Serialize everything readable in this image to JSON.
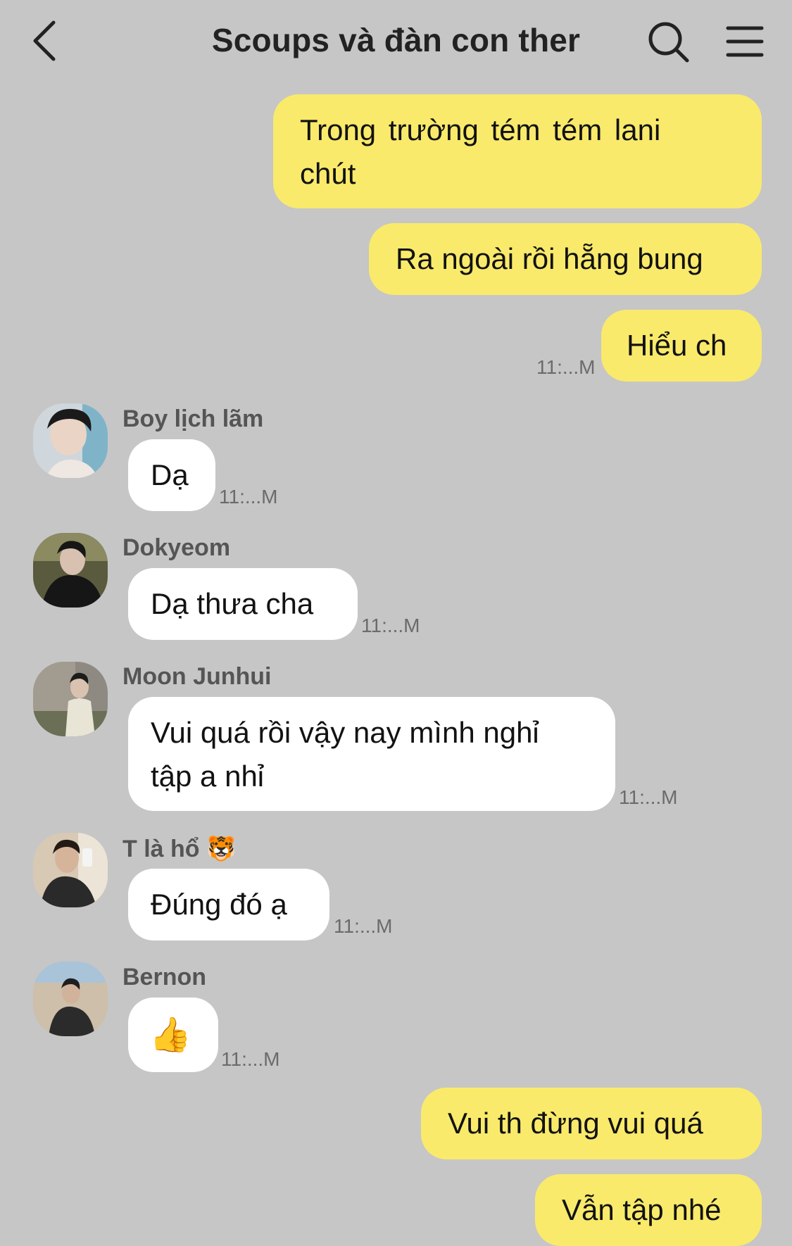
{
  "header": {
    "title": "Scoups và đàn con ther",
    "back_icon": "chevron-left-icon",
    "search_icon": "search-icon",
    "menu_icon": "hamburger-menu-icon"
  },
  "messages": [
    {
      "from": "me",
      "text_line1": "Trong  trường  tém  tém  lani",
      "text_line2": "chút"
    },
    {
      "from": "me",
      "text": "Ra ngoài rồi hẵng bung"
    },
    {
      "from": "me",
      "text": "Hiểu ch",
      "time": "11:...M"
    },
    {
      "from": "Boy lịch lãm",
      "text": "Dạ",
      "time": "11:...M"
    },
    {
      "from": "Dokyeom",
      "text": "Dạ thưa cha",
      "time": "11:...M"
    },
    {
      "from": "Moon Junhui",
      "text_line1": "Vui quá rồi vậy nay mình nghỉ",
      "text_line2": "tập a nhỉ",
      "time": "11:...M"
    },
    {
      "from": "T là hổ",
      "sender_emoji": "🐯",
      "text": "Đúng đó ạ",
      "time": "11:...M"
    },
    {
      "from": "Bernon",
      "text": "👍",
      "time": "11:...M"
    },
    {
      "from": "me",
      "text": "Vui th đừng vui quá"
    },
    {
      "from": "me",
      "text": "Vẫn tập nhé"
    }
  ],
  "colors": {
    "background": "#c6c6c7",
    "my_bubble": "#f9ea6b",
    "their_bubble": "#ffffff"
  }
}
